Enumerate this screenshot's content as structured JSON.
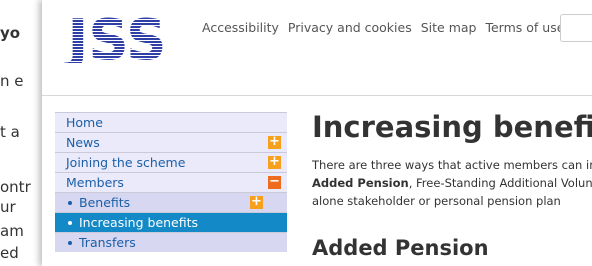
{
  "background_page": {
    "lines": [
      "yo",
      "n e",
      "t a",
      "ontr",
      "ur",
      "am",
      "ed"
    ]
  },
  "header": {
    "logo_text": "JSS",
    "links": [
      "Accessibility",
      "Privacy and cookies",
      "Site map",
      "Terms of use"
    ]
  },
  "nav": {
    "items": [
      {
        "label": "Home",
        "toggle": ""
      },
      {
        "label": "News",
        "toggle": "+"
      },
      {
        "label": "Joining the scheme",
        "toggle": "+"
      },
      {
        "label": "Members",
        "toggle": "−"
      },
      {
        "label": "Benefits",
        "toggle": "+"
      },
      {
        "label": "Increasing benefits",
        "toggle": ""
      },
      {
        "label": "Transfers",
        "toggle": ""
      }
    ]
  },
  "main": {
    "title": "Increasing benefits",
    "para_line1": "There are three ways that active members can incre",
    "para_bold1": "Added Pension",
    "para_line2_rest": ", Free-Standing Additional Voluntar",
    "para_line3": "alone stakeholder or personal pension plan",
    "subtitle": "Added Pension"
  },
  "colors": {
    "nav_active": "#1489c8",
    "nav_toggle": "#f7a01e",
    "link": "#1b5fa8",
    "logo_blue": "#2f3fa6"
  }
}
